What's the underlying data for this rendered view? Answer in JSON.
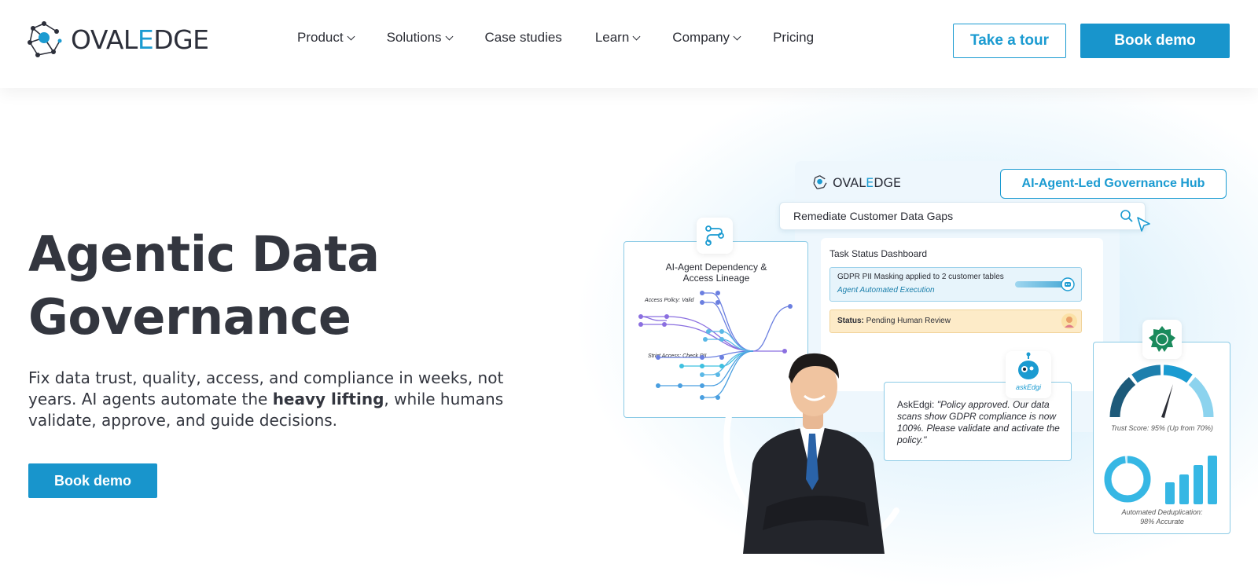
{
  "brand": {
    "logo_text_a": "OVAL",
    "logo_text_e": "E",
    "logo_text_b": "DGE"
  },
  "nav": {
    "items": [
      {
        "label": "Product",
        "dropdown": true
      },
      {
        "label": "Solutions",
        "dropdown": true
      },
      {
        "label": "Case studies",
        "dropdown": false
      },
      {
        "label": "Learn",
        "dropdown": true
      },
      {
        "label": "Company",
        "dropdown": true
      },
      {
        "label": "Pricing",
        "dropdown": false
      }
    ],
    "tour_label": "Take a tour",
    "demo_label": "Book demo"
  },
  "hero": {
    "title_line1": "Agentic Data",
    "title_line2": "Governance",
    "sub_part1": "Fix data trust, quality, access, and compliance in weeks, not years. AI agents automate the ",
    "sub_bold": "heavy lifting",
    "sub_part2": ", while humans validate, approve, and guide decisions.",
    "cta_label": "Book demo"
  },
  "illustration": {
    "mini_logo_a": "OVAL",
    "mini_logo_e": "E",
    "mini_logo_b": "DGE",
    "hub_tag": "AI-Agent-Led Governance Hub",
    "search_text": "Remediate Customer Data Gaps",
    "dashboard": {
      "title": "Task Status Dashboard",
      "row1_title": "GDPR PII Masking applied to 2 customer tables",
      "row1_sub": "Agent Automated Execution",
      "row2_label": "Status:",
      "row2_value": " Pending Human Review"
    },
    "lineage": {
      "title": "AI-Agent Dependency & Access Lineage",
      "label1": "Access Policy: Valid",
      "label2": "Strict Access: Check PII"
    },
    "trust": {
      "score_caption": "Trust Score: 95% (Up from 70%)",
      "dedup_caption_1": "Automated Deduplication:",
      "dedup_caption_2": "98% Accurate"
    },
    "askedgi": {
      "label": "askEdgi",
      "speaker": "AskEdgi: ",
      "quote": "\"Policy approved. Our data scans show GDPR compliance is now 100%. Please validate and activate the policy.\""
    }
  },
  "colors": {
    "accent": "#1895cc",
    "text": "#2b2d35"
  }
}
